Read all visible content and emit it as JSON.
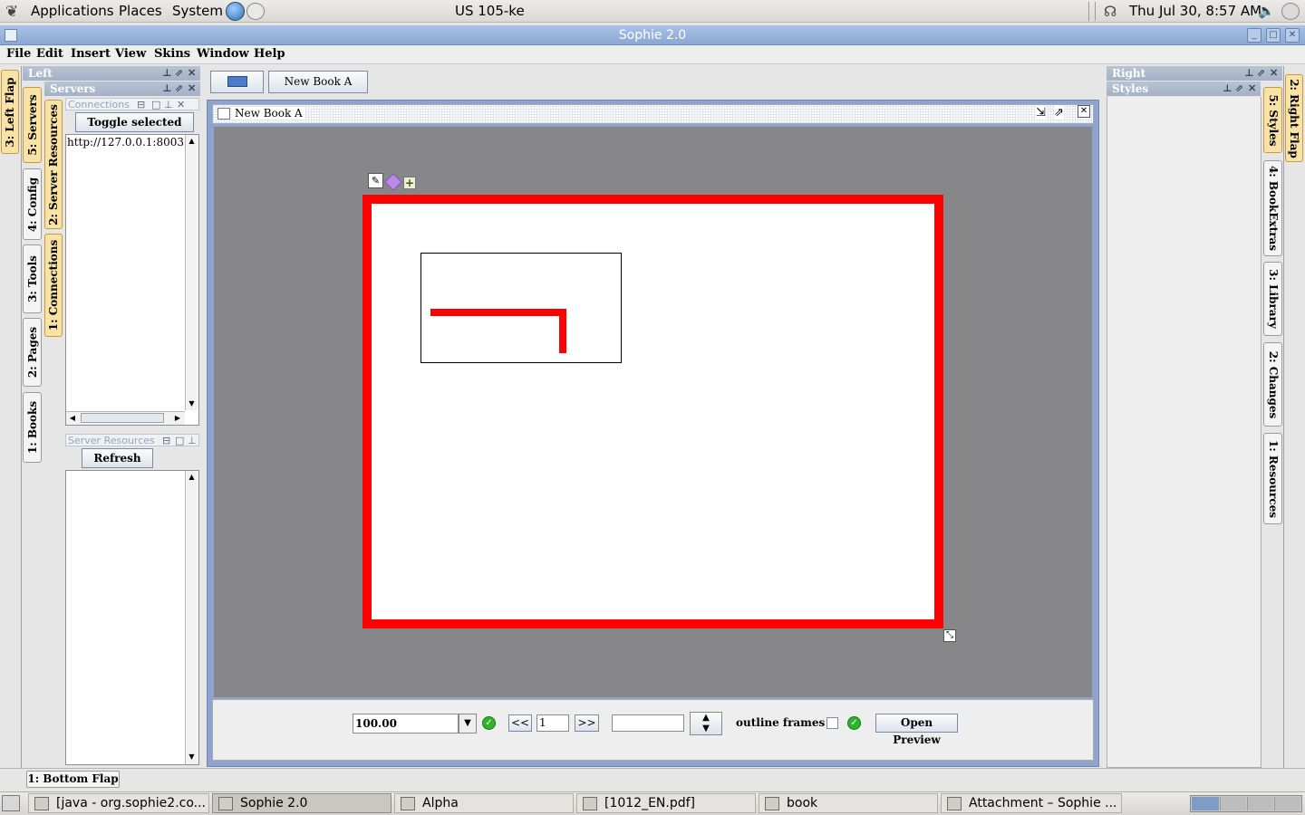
{
  "top_panel": {
    "menus": [
      "Applications",
      "Places",
      "System"
    ],
    "center_label": "US 105-ke",
    "clock": "Thu Jul 30,  8:57 AM",
    "icons": [
      "gnome-foot-icon",
      "globe-icon",
      "mail-icon",
      "network-icon",
      "volume-icon"
    ]
  },
  "window": {
    "title": "Sophie 2.0"
  },
  "menubar": {
    "items": [
      "File",
      "Edit",
      "Insert",
      "View",
      "Skins",
      "Window",
      "Help"
    ]
  },
  "left_flap": {
    "outer_tabs": [
      "3: Left Flap"
    ],
    "side_tabs": [
      "5: Servers",
      "4: Config",
      "3: Tools",
      "2: Pages",
      "1: Books"
    ],
    "header": "Left",
    "servers_header": "Servers",
    "inner_tabs": [
      "2: Server Resources",
      "1: Connections"
    ],
    "connections": {
      "title": "Connections",
      "toggle_button": "Toggle selected",
      "items": [
        "http://127.0.0.1:8003"
      ]
    },
    "server_resources": {
      "title": "Server Resources",
      "refresh_button": "Refresh"
    }
  },
  "right_flap": {
    "header": "Right",
    "styles_header": "Styles",
    "outer_tabs": [
      "2: Right Flap"
    ],
    "side_tabs": [
      "5: Styles",
      "4: BookExtras",
      "3: Library",
      "2: Changes",
      "1: Resources"
    ]
  },
  "bottom_flap": {
    "tab": "1: Bottom Flap"
  },
  "doc_tabs": {
    "book_button": "New Book A"
  },
  "document": {
    "title": "New Book A",
    "zoom": "100.00",
    "prev_page": "<<",
    "page_number": "1",
    "next_page": ">>",
    "outline_frames_label": "outline frames",
    "open_preview": "Open Preview"
  },
  "colors": {
    "page_border": "#ff0000",
    "canvas": "#87878a",
    "tab_selected": "#f8e2a6"
  },
  "taskbar": {
    "tasks": [
      "[java - org.sophie2.co...",
      "Sophie 2.0",
      "Alpha",
      "[1012_EN.pdf]",
      "book",
      "Attachment – Sophie ..."
    ]
  }
}
